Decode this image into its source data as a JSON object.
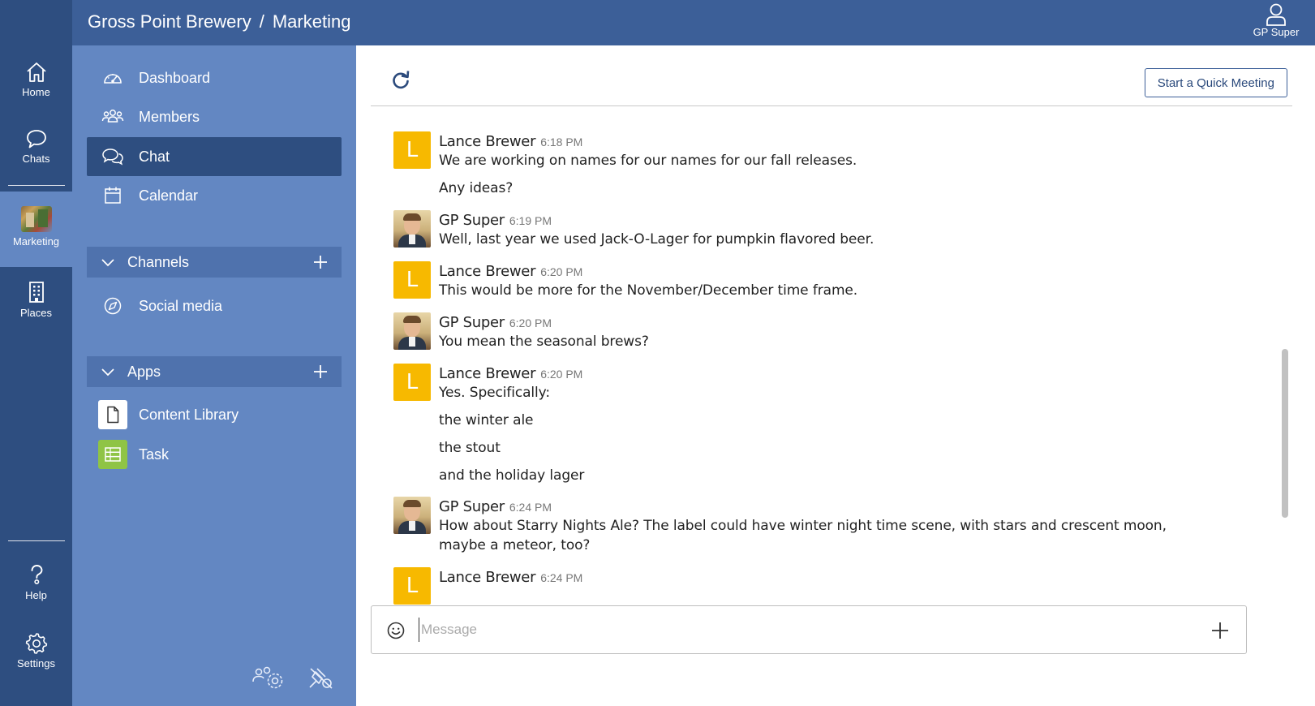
{
  "header": {
    "team_name": "Gross Point Brewery",
    "separator": "/",
    "channel_name": "Marketing",
    "user_label": "GP Super",
    "bg_color": "#3c5f98"
  },
  "rail": {
    "items": [
      {
        "label": "Home",
        "icon": "home-icon"
      },
      {
        "label": "Chats",
        "icon": "chat-bubble-icon"
      },
      {
        "label": "Marketing",
        "icon": "team-thumbnail"
      },
      {
        "label": "Places",
        "icon": "building-icon"
      },
      {
        "label": "Help",
        "icon": "help-icon"
      },
      {
        "label": "Settings",
        "icon": "gear-icon"
      }
    ],
    "active": "Marketing"
  },
  "sidenav": {
    "items": [
      {
        "label": "Dashboard",
        "icon": "gauge-icon"
      },
      {
        "label": "Members",
        "icon": "members-icon"
      },
      {
        "label": "Chat",
        "icon": "chat-icon",
        "active": true
      },
      {
        "label": "Calendar",
        "icon": "calendar-icon"
      }
    ],
    "channels_header": "Channels",
    "channels": [
      {
        "label": "Social media",
        "icon": "compass-icon"
      }
    ],
    "apps_header": "Apps",
    "apps": [
      {
        "label": "Content Library",
        "icon": "document-icon"
      },
      {
        "label": "Task",
        "icon": "task-icon"
      }
    ]
  },
  "toolbar": {
    "quick_meeting_label": "Start a Quick Meeting"
  },
  "messages": [
    {
      "sender": "Lance Brewer",
      "time": "6:18 PM",
      "avatar": "L",
      "lines": [
        "We are working on names for our names for our fall releases.",
        "Any ideas?"
      ]
    },
    {
      "sender": "GP Super",
      "time": "6:19 PM",
      "avatar": "photo",
      "lines": [
        "Well, last year we used Jack-O-Lager for pumpkin flavored beer."
      ]
    },
    {
      "sender": "Lance Brewer",
      "time": "6:20 PM",
      "avatar": "L",
      "lines": [
        "This would be more for the November/December time frame."
      ]
    },
    {
      "sender": "GP Super",
      "time": "6:20 PM",
      "avatar": "photo",
      "lines": [
        "You mean the seasonal brews?"
      ]
    },
    {
      "sender": "Lance Brewer",
      "time": "6:20 PM",
      "avatar": "L",
      "lines": [
        "Yes. Specifically:",
        "the winter ale",
        "the stout",
        "and the holiday lager"
      ]
    },
    {
      "sender": "GP Super",
      "time": "6:24 PM",
      "avatar": "photo",
      "lines": [
        "How about Starry Nights Ale? The label could have winter night time scene, with stars and crescent moon, maybe a meteor, too?"
      ]
    },
    {
      "sender": "Lance Brewer",
      "time": "6:24 PM",
      "avatar": "L",
      "lines": []
    }
  ],
  "composer": {
    "placeholder": "Message",
    "value": ""
  },
  "colors": {
    "rail": "#2e4e80",
    "sidenav": "#6387c2",
    "section_header": "#4f72ad",
    "letter_avatar": "#f7b900",
    "task_tile": "#8fc445"
  }
}
